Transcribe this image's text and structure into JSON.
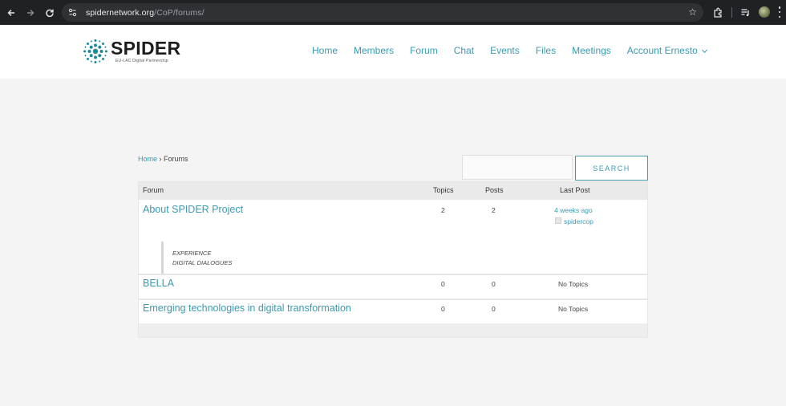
{
  "browser": {
    "url_host": "spidernetwork.org",
    "url_path": "/CoP/forums/"
  },
  "site": {
    "logo_title": "SPIDER",
    "logo_subtitle": "EU-LAC Digital Partnership",
    "nav": [
      "Home",
      "Members",
      "Forum",
      "Chat",
      "Events",
      "Files",
      "Meetings",
      "Account Ernesto"
    ]
  },
  "breadcrumb": {
    "home": "Home",
    "separator": "›",
    "current": "Forums"
  },
  "search": {
    "placeholder": "",
    "button_label": "SEARCH"
  },
  "table": {
    "headers": {
      "forum": "Forum",
      "topics": "Topics",
      "posts": "Posts",
      "last_post": "Last Post"
    },
    "rows": [
      {
        "title": "About SPIDER Project",
        "topics": "2",
        "posts": "2",
        "last_post_time": "4 weeks ago",
        "last_post_user": "spidercop",
        "subforums": [
          "EXPERIENCE",
          "DIGITAL DIALOGUES"
        ]
      },
      {
        "title": "BELLA",
        "topics": "0",
        "posts": "0",
        "last_post": "No Topics"
      },
      {
        "title": "Emerging technologies in digital transformation",
        "topics": "0",
        "posts": "0",
        "last_post": "No Topics"
      }
    ]
  },
  "colors": {
    "accent": "#3d9ab0",
    "chrome_bg": "#202124",
    "page_bg": "#f4f4f4"
  }
}
